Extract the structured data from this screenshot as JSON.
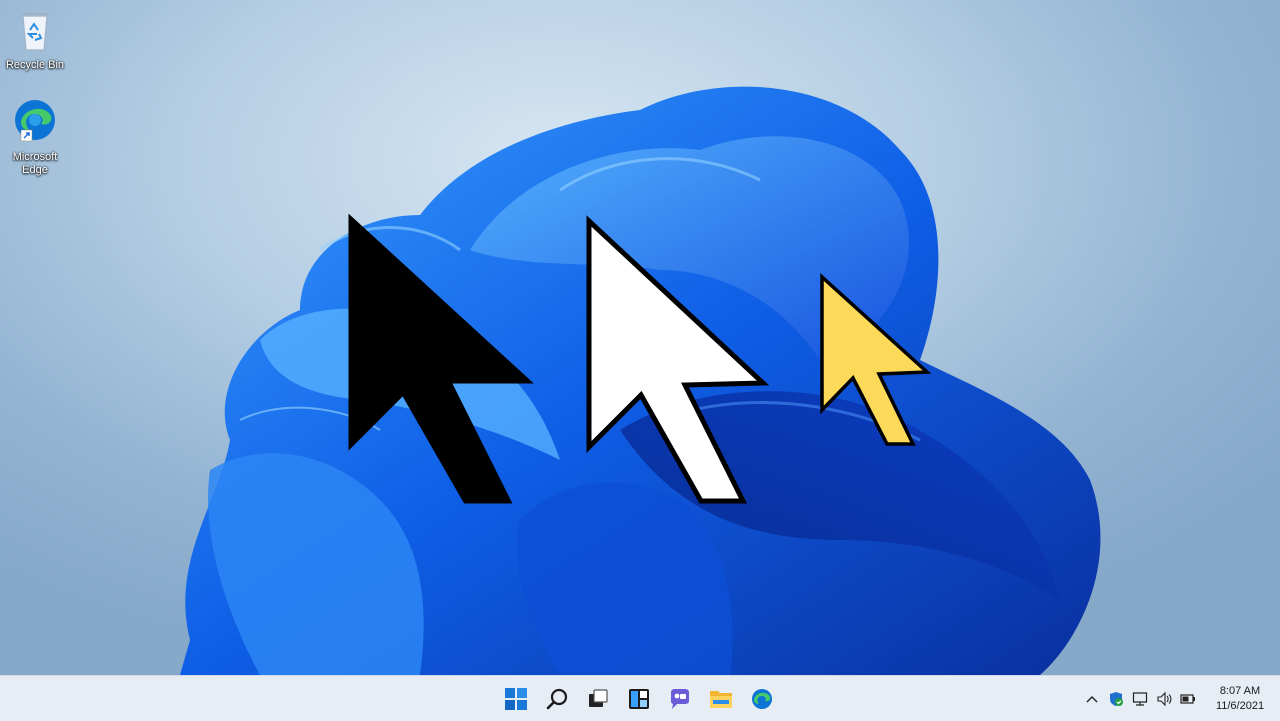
{
  "desktop": {
    "icons": [
      {
        "label": "Recycle Bin",
        "icon": "recycle-bin-icon"
      },
      {
        "label": "Microsoft Edge",
        "icon": "edge-icon"
      }
    ]
  },
  "cursors": [
    {
      "name": "black-cursor",
      "color": "#000000"
    },
    {
      "name": "white-cursor",
      "color": "#ffffff"
    },
    {
      "name": "yellow-cursor",
      "color": "#fcd958"
    }
  ],
  "taskbar": {
    "apps": [
      "start-icon",
      "search-icon",
      "task-view-icon",
      "widgets-icon",
      "chat-icon",
      "file-explorer-icon",
      "edge-icon"
    ],
    "tray": [
      "chevron-up-icon",
      "security-icon",
      "network-icon",
      "volume-icon",
      "battery-icon"
    ],
    "time": "8:07 AM",
    "date": "11/6/2021"
  },
  "colors": {
    "accent": "#0067c0",
    "taskbar": "#e6edf5"
  }
}
